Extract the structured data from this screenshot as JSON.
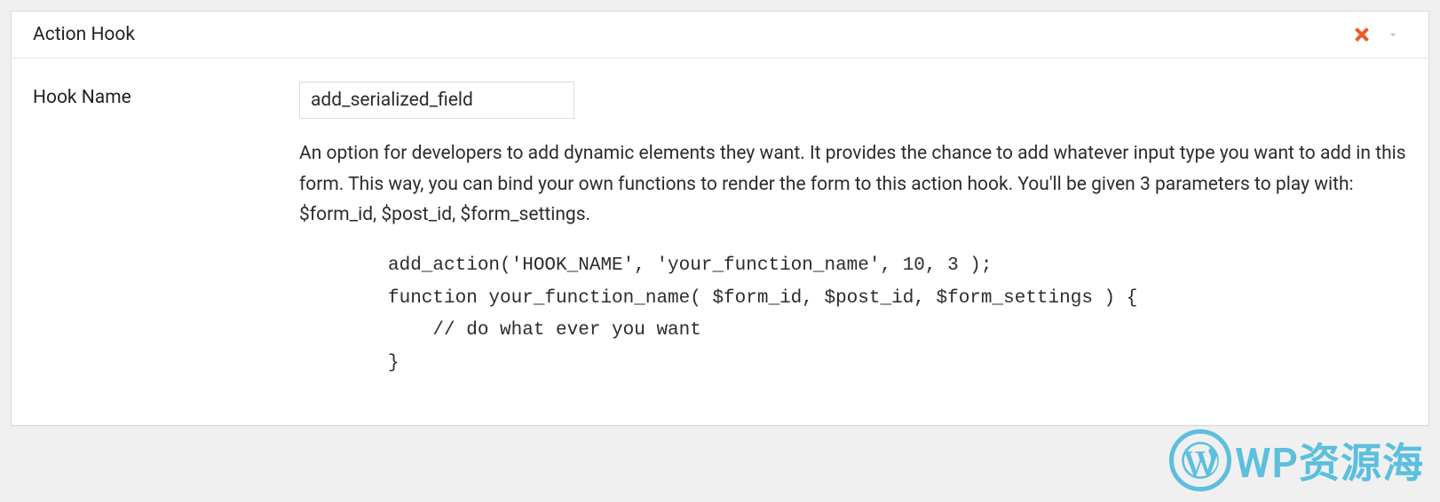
{
  "panel": {
    "title": "Action Hook",
    "field_label": "Hook Name",
    "hook_value": "add_serialized_field",
    "description": "An option for developers to add dynamic elements they want. It provides the chance to add whatever input type you want to add in this form. This way, you can bind your own functions to render the form to this action hook. You'll be given 3 parameters to play with: $form_id, $post_id, $form_settings.",
    "code": "add_action('HOOK_NAME', 'your_function_name', 10, 3 );\nfunction your_function_name( $form_id, $post_id, $form_settings ) {\n    // do what ever you want\n}"
  },
  "watermark": {
    "text": "WP资源海"
  }
}
